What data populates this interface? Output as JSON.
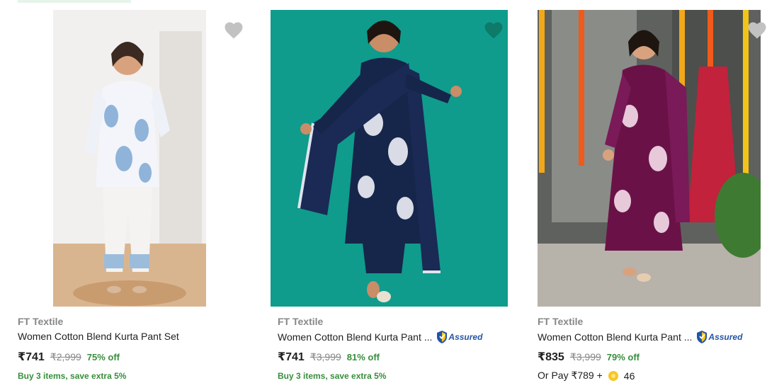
{
  "products": [
    {
      "brand": "FT Textile",
      "title": "Women Cotton Blend Kurta Pant Set",
      "assured": false,
      "price": "₹741",
      "mrp": "₹2,999",
      "discount": "75% off",
      "offer": "Buy 3 items, save extra 5%",
      "wishlist_color": "#c2c2c2",
      "image_bg": "#eceae8"
    },
    {
      "brand": "FT Textile",
      "title": "Women Cotton Blend Kurta Pant ...",
      "assured": true,
      "assured_label": "Assured",
      "price": "₹741",
      "mrp": "₹3,999",
      "discount": "81% off",
      "offer": "Buy 3 items, save extra 5%",
      "wishlist_color": "#0d7a6a",
      "image_bg": "#0f9c8c"
    },
    {
      "brand": "FT Textile",
      "title": "Women Cotton Blend Kurta Pant ...",
      "assured": true,
      "assured_label": "Assured",
      "price": "₹835",
      "mrp": "₹3,999",
      "discount": "79% off",
      "pay_prefix": "Or Pay ₹789 +",
      "pay_coins": "46",
      "wishlist_color": "#c2c2c2",
      "image_bg": "#5a5a58"
    }
  ],
  "icons": {
    "wishlist": "heart-icon",
    "assured": "assured-shield-icon",
    "coin": "supercoin-icon"
  }
}
